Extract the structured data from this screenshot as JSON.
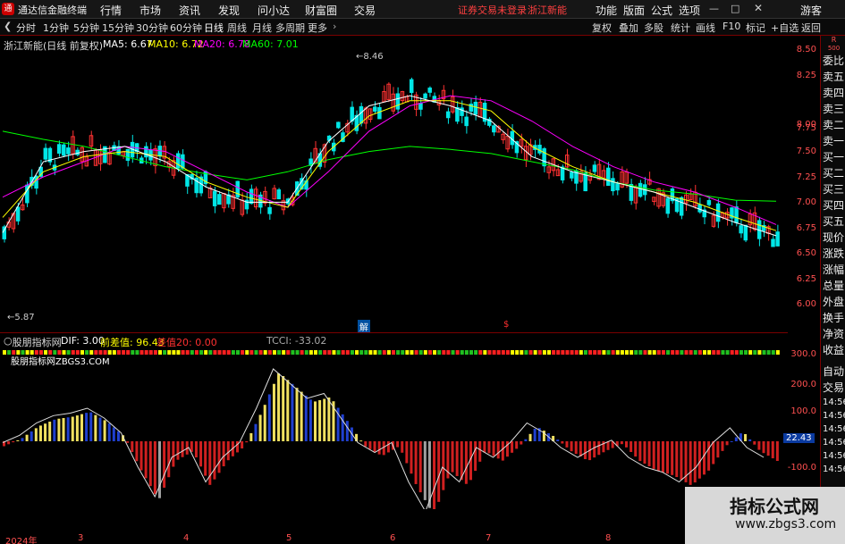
{
  "app": {
    "logo": "通",
    "title": "通达信金融终端"
  },
  "menu": [
    "行情",
    "市场",
    "资讯",
    "发现",
    "问小达",
    "财富圈",
    "交易"
  ],
  "status": {
    "login": "证券交易未登录",
    "stock": "浙江新能"
  },
  "top_right": [
    "功能",
    "版面",
    "公式",
    "选项"
  ],
  "user": "游客",
  "window_controls": [
    "minimize-icon",
    "restore-icon",
    "close-icon"
  ],
  "toolbar": {
    "periods": [
      "分时",
      "1分钟",
      "5分钟",
      "15分钟",
      "30分钟",
      "60分钟",
      "日线",
      "周线",
      "月线",
      "多周期",
      "更多"
    ],
    "active_period": "日线",
    "right_tools": [
      "复权",
      "叠加",
      "多股",
      "统计",
      "画线",
      "F10",
      "标记",
      "+自选",
      "返回"
    ]
  },
  "price_info": {
    "label": "浙江新能(日线 前复权)",
    "ma5": "MA5: 6.67",
    "ma10": "MA10: 6.72",
    "ma20": "MA20: 6.78",
    "ma60": "MA60: 7.01"
  },
  "annotations": {
    "high": "8.46",
    "low": "5.87",
    "tag1": "解",
    "tag2": "$"
  },
  "price_axis": [
    "8.50",
    "8.25",
    "8.00",
    "7.75",
    "7.50",
    "7.25",
    "7.00",
    "6.75",
    "6.50",
    "6.25",
    "6.00"
  ],
  "indicator_info": {
    "label": "股朋指标网",
    "dif": "DIF: 3.00",
    "qian": "前差值: 96.43",
    "cha": "差值20: 0.00",
    "tcci": "TCCI: -33.02",
    "site": "股朋指标网ZBGS3.COM"
  },
  "indicator_axis": [
    "300.0",
    "200.0",
    "100.0",
    "-100.0"
  ],
  "current_value": "22.43",
  "date_axis": [
    "2024年",
    "3",
    "4",
    "5",
    "6",
    "7",
    "8"
  ],
  "side_panel": [
    "R",
    "500",
    "委比",
    "卖五",
    "卖四",
    "卖三",
    "卖二",
    "卖一",
    "买一",
    "买二",
    "买三",
    "买四",
    "买五",
    "现价",
    "涨跌",
    "涨幅",
    "总量",
    "外盘",
    "换手",
    "净资",
    "收益",
    "自动",
    "交易",
    "14:56",
    "14:56",
    "14:56",
    "14:56",
    "14:56",
    "14:56",
    "14:56",
    "14:56"
  ],
  "watermark": {
    "title": "指标公式网",
    "url": "www.zbgs3.com"
  },
  "colors": {
    "up": "#ff3232",
    "down": "#00e6e6",
    "ma5": "#ffffff",
    "ma10": "#ffff00",
    "ma20": "#ff00ff",
    "ma60": "#00ff00"
  },
  "chart_data": {
    "type": "line",
    "series": [
      {
        "name": "MA60",
        "y": [
          7.7,
          7.62,
          7.55,
          7.45,
          7.35,
          7.28,
          7.22,
          7.3,
          7.42,
          7.5,
          7.55,
          7.52,
          7.48,
          7.4,
          7.32,
          7.2,
          7.12,
          7.08,
          7.02,
          7.01
        ]
      },
      {
        "name": "MA20",
        "y": [
          7.05,
          7.25,
          7.4,
          7.55,
          7.5,
          7.3,
          7.1,
          6.95,
          7.3,
          7.7,
          7.95,
          8.05,
          8.0,
          7.8,
          7.55,
          7.35,
          7.2,
          7.1,
          6.95,
          6.78
        ]
      },
      {
        "name": "MA10",
        "y": [
          6.85,
          7.3,
          7.45,
          7.5,
          7.45,
          7.2,
          7.05,
          6.95,
          7.5,
          7.85,
          8.0,
          8.0,
          7.9,
          7.55,
          7.35,
          7.2,
          7.1,
          7.0,
          6.85,
          6.72
        ]
      },
      {
        "name": "MA5",
        "y": [
          6.7,
          7.4,
          7.5,
          7.55,
          7.4,
          7.15,
          7.0,
          7.0,
          7.6,
          7.95,
          8.05,
          7.95,
          7.8,
          7.45,
          7.3,
          7.2,
          7.1,
          6.95,
          6.8,
          6.67
        ]
      }
    ]
  }
}
